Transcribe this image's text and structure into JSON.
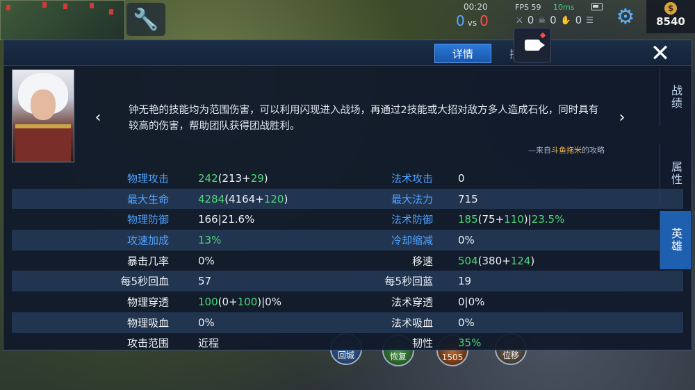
{
  "hud": {
    "time": "00:20",
    "score_blue": "0",
    "score_vs": "vs",
    "score_red": "0",
    "fps": "FPS 59",
    "ping": "10ms",
    "kills": "0",
    "deaths": "0",
    "assists": "0",
    "gold": "8540",
    "gold_icon": "$"
  },
  "skills": [
    "回城",
    "恢复",
    "1505",
    "位移"
  ],
  "panel": {
    "tabs": [
      {
        "label": "详情",
        "active": true
      },
      {
        "label": "技能",
        "active": false
      }
    ],
    "prev_arrow": "‹",
    "next_arrow": "›",
    "close": "✕",
    "description": "钟无艳的技能均为范围伤害，可以利用闪现进入战场，再通过2技能或大招对敌方多人造成石化，同时具有较高的伤害，帮助团队获得团战胜利。",
    "source_prefix": "—来自",
    "source_author": "斗鱼拖米",
    "source_suffix": "的攻略",
    "side_tabs": [
      {
        "label": "战绩",
        "active": false
      },
      {
        "label": "属性",
        "active": false
      },
      {
        "label": "英雄",
        "active": true
      }
    ]
  },
  "stats": [
    {
      "l_label": "物理攻击",
      "l_color": "blue",
      "l_value": [
        [
          "242",
          "g"
        ],
        [
          "(213+",
          "w"
        ],
        [
          "29",
          "g"
        ],
        [
          ")",
          "w"
        ]
      ],
      "r_label": "法术攻击",
      "r_color": "blue",
      "r_value": [
        [
          "0",
          "w"
        ]
      ]
    },
    {
      "l_label": "最大生命",
      "l_color": "blue",
      "l_value": [
        [
          "4284",
          "g"
        ],
        [
          "(4164+",
          "w"
        ],
        [
          "120",
          "g"
        ],
        [
          ")",
          "w"
        ]
      ],
      "r_label": "最大法力",
      "r_color": "blue",
      "r_value": [
        [
          "715",
          "w"
        ]
      ]
    },
    {
      "l_label": "物理防御",
      "l_color": "blue",
      "l_value": [
        [
          "166|21.6%",
          "w"
        ]
      ],
      "r_label": "法术防御",
      "r_color": "blue",
      "r_value": [
        [
          "185",
          "g"
        ],
        [
          "(75+",
          "w"
        ],
        [
          "110",
          "g"
        ],
        [
          ")|",
          "w"
        ],
        [
          "23.5%",
          "g"
        ]
      ]
    },
    {
      "l_label": "攻速加成",
      "l_color": "blue",
      "l_value": [
        [
          "13%",
          "g"
        ]
      ],
      "r_label": "冷却缩减",
      "r_color": "blue",
      "r_value": [
        [
          "0%",
          "w"
        ]
      ]
    },
    {
      "l_label": "暴击几率",
      "l_color": "white",
      "l_value": [
        [
          "0%",
          "w"
        ]
      ],
      "r_label": "移速",
      "r_color": "white",
      "r_value": [
        [
          "504",
          "g"
        ],
        [
          "(380+",
          "w"
        ],
        [
          "124",
          "g"
        ],
        [
          ")",
          "w"
        ]
      ]
    },
    {
      "l_label": "每5秒回血",
      "l_color": "white",
      "l_value": [
        [
          "57",
          "w"
        ]
      ],
      "r_label": "每5秒回蓝",
      "r_color": "white",
      "r_value": [
        [
          "19",
          "w"
        ]
      ]
    },
    {
      "l_label": "物理穿透",
      "l_color": "white",
      "l_value": [
        [
          "100",
          "g"
        ],
        [
          "(0+",
          "w"
        ],
        [
          "100",
          "g"
        ],
        [
          ")|0%",
          "w"
        ]
      ],
      "r_label": "法术穿透",
      "r_color": "white",
      "r_value": [
        [
          "0|0%",
          "w"
        ]
      ]
    },
    {
      "l_label": "物理吸血",
      "l_color": "white",
      "l_value": [
        [
          "0%",
          "w"
        ]
      ],
      "r_label": "法术吸血",
      "r_color": "white",
      "r_value": [
        [
          "0%",
          "w"
        ]
      ]
    },
    {
      "l_label": "攻击范围",
      "l_color": "white",
      "l_value": [
        [
          "近程",
          "w"
        ]
      ],
      "r_label": "韧性",
      "r_color": "white",
      "r_value": [
        [
          "35%",
          "g"
        ]
      ]
    }
  ]
}
